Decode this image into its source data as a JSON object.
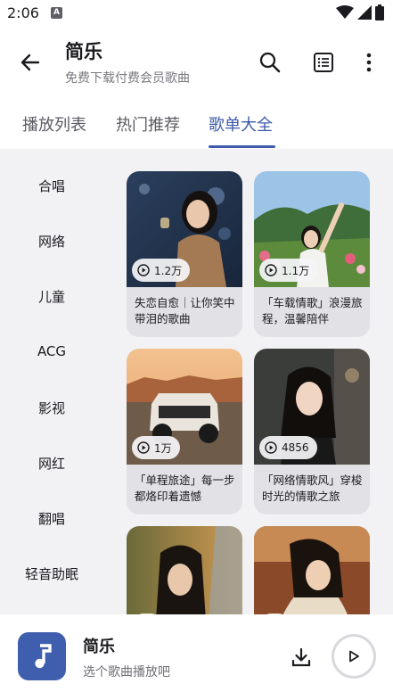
{
  "status": {
    "time": "2:06",
    "app_badge": "A"
  },
  "header": {
    "title": "简乐",
    "subtitle": "免费下载付费会员歌曲"
  },
  "tabs": [
    {
      "label": "播放列表",
      "active": false
    },
    {
      "label": "热门推荐",
      "active": false
    },
    {
      "label": "歌单大全",
      "active": true
    }
  ],
  "categories": [
    "合唱",
    "网络",
    "儿童",
    "ACG",
    "影视",
    "网红",
    "翻唱",
    "轻音助眠"
  ],
  "playlists": [
    {
      "plays": "1.2万",
      "title": "失恋自愈｜让你笑中带泪的歌曲"
    },
    {
      "plays": "1.1万",
      "title": "「车载情歌」浪漫旅程，温馨陪伴"
    },
    {
      "plays": "1万",
      "title": "「单程旅途」每一步都烙印着遗憾"
    },
    {
      "plays": "4856",
      "title": "「网络情歌风」穿梭时光的情歌之旅"
    },
    {
      "plays": "",
      "title": ""
    },
    {
      "plays": "",
      "title": ""
    }
  ],
  "player": {
    "title": "简乐",
    "subtitle": "选个歌曲播放吧"
  },
  "colors": {
    "accent": "#3d5ba9",
    "cover": "#3f5fae",
    "content_bg": "#f2f2f4"
  },
  "icons": [
    "back-arrow-icon",
    "search-icon",
    "list-icon",
    "more-vert-icon",
    "play-circle-icon",
    "music-note-icon",
    "download-icon",
    "play-icon"
  ]
}
